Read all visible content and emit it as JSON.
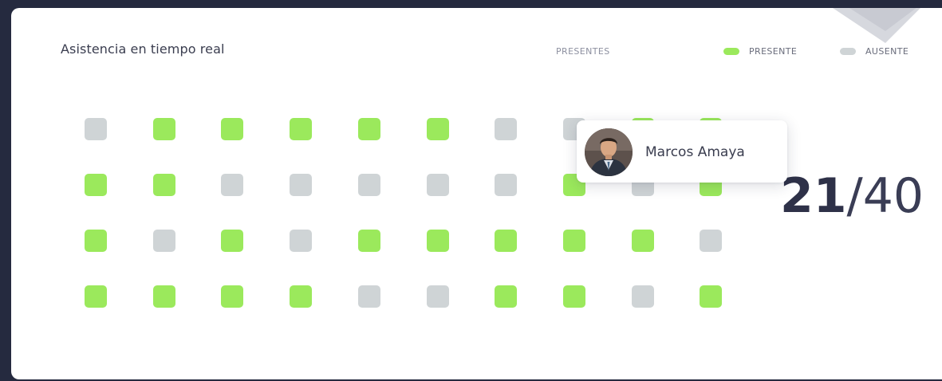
{
  "header": {
    "title": "Asistencia en tiempo real",
    "presentes_label": "PRESENTES"
  },
  "legend": {
    "present_label": "PRESENTE",
    "absent_label": "AUSENTE"
  },
  "colors": {
    "present": "#9be95c",
    "absent": "#cfd4d6",
    "background": "#252a3f",
    "card": "#ffffff"
  },
  "attendance": {
    "present_count": "21",
    "total_suffix": "/40",
    "grid": [
      [
        0,
        1,
        1,
        1,
        1,
        1,
        0,
        0,
        1,
        1
      ],
      [
        1,
        1,
        0,
        0,
        0,
        0,
        0,
        1,
        0,
        1
      ],
      [
        1,
        0,
        1,
        0,
        1,
        1,
        1,
        1,
        1,
        0
      ],
      [
        1,
        1,
        1,
        1,
        0,
        0,
        1,
        1,
        0,
        1
      ]
    ]
  },
  "tooltip": {
    "name": "Marcos Amaya"
  }
}
